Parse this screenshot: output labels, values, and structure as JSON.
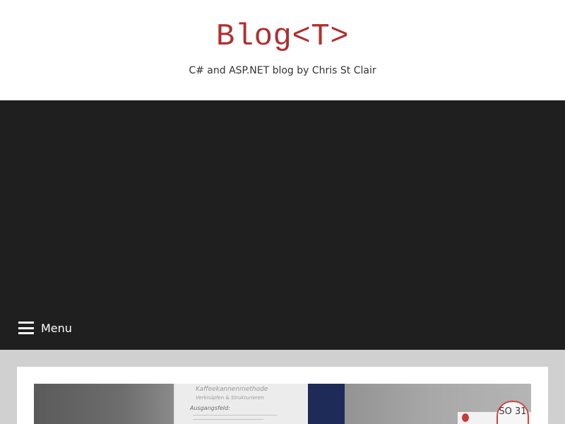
{
  "site": {
    "title": "Blog<T>",
    "tagline": "C# and ASP.NET blog by Chris St Clair"
  },
  "nav": {
    "menu_label": "Menu",
    "menu_icon": "hamburger-icon"
  },
  "post": {
    "featured_image_text": {
      "board_heading": "Kaffeekannenmethode",
      "board_subheading": "Verknüpfen & Strukturieren",
      "board_label": "Ausgangsfeld:",
      "cloud_text": "SO 31"
    }
  },
  "colors": {
    "title": "#b03030",
    "header_band": "#1f1f1f",
    "page_background": "#d0d0d0",
    "card_background": "#ffffff"
  }
}
